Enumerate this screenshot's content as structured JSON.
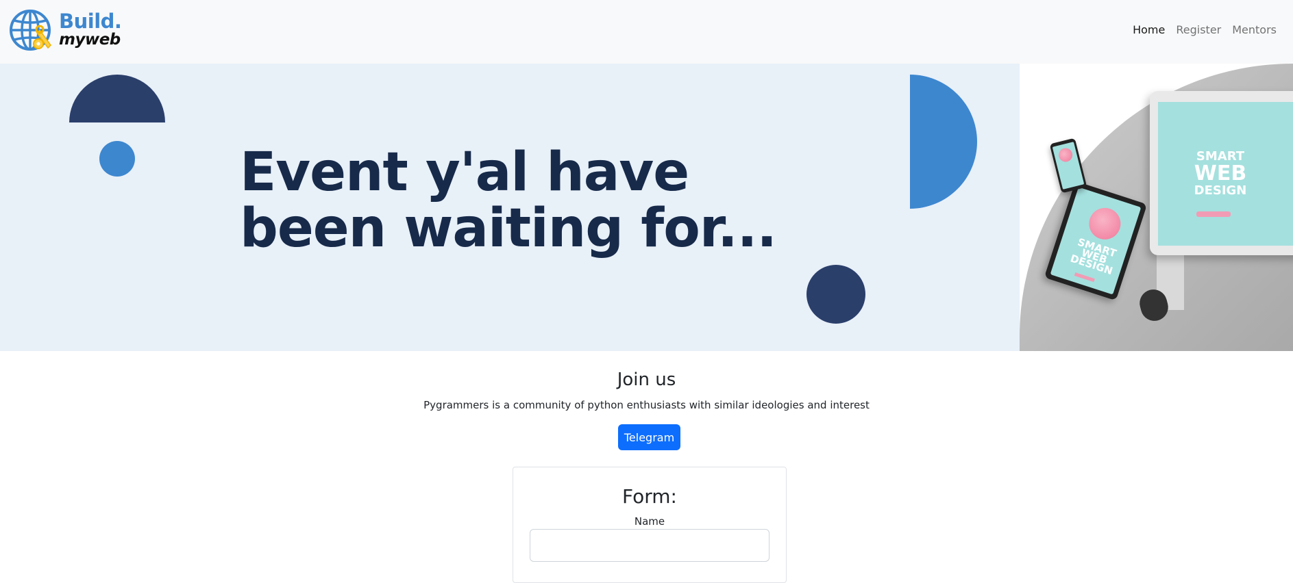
{
  "brand": {
    "line1": "Build.",
    "line2": "myweb",
    "logo_icon": "globe-wrench-icon",
    "primary_color": "#3d87cf",
    "dark_color": "#2b3f6b"
  },
  "nav": {
    "items": [
      {
        "label": "Home",
        "active": true
      },
      {
        "label": "Register",
        "active": false
      },
      {
        "label": "Mentors",
        "active": false
      }
    ]
  },
  "hero": {
    "title": "Event y'al have been waiting for...",
    "background": "#e8f0f8",
    "image": {
      "screen_line1": "SMART",
      "screen_line2": "WEB",
      "screen_line3": "DESIGN",
      "tablet_line1": "SMART",
      "tablet_line2": "WEB",
      "tablet_line3": "DESIGN"
    }
  },
  "join": {
    "title": "Join us",
    "description": "Pygrammers is a community of python enthusiasts with similar ideologies and interest",
    "button_label": "Telegram",
    "button_color": "#0d6efd"
  },
  "form": {
    "title": "Form:",
    "fields": [
      {
        "label": "Name",
        "value": "",
        "placeholder": ""
      }
    ]
  }
}
